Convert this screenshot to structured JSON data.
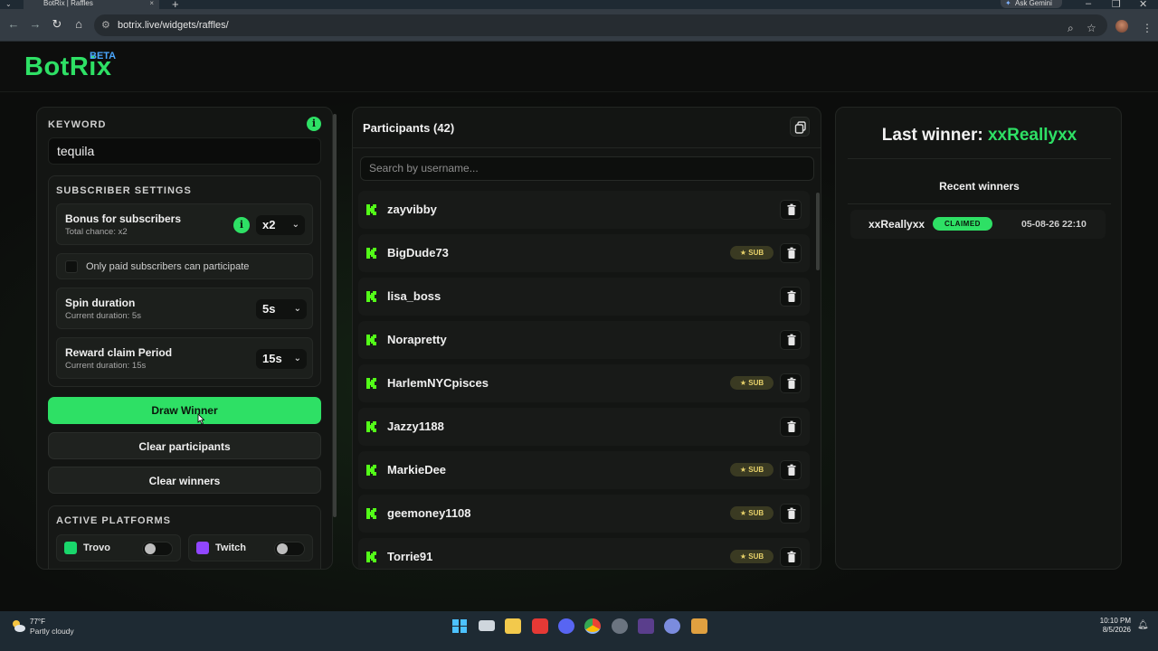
{
  "browser": {
    "tab_title": "BotRix | Raffles",
    "tab_close": "×",
    "new_tab": "+",
    "gemini": "Ask Gemini",
    "url": "botrix.live/widgets/raffles/",
    "window_controls": [
      "–",
      "❐",
      "✕"
    ]
  },
  "app": {
    "logo": "BotRix",
    "beta": "BETA"
  },
  "settings": {
    "keyword_label": "KEYWORD",
    "keyword_value": "tequila",
    "subscriber_title": "SUBSCRIBER SETTINGS",
    "bonus_title": "Bonus for subscribers",
    "bonus_sub": "Total chance: x2",
    "bonus_value": "x2",
    "paid_only_label": "Only paid subscribers can participate",
    "spin_title": "Spin duration",
    "spin_sub": "Current duration: 5s",
    "spin_value": "5s",
    "claim_title": "Reward claim Period",
    "claim_sub": "Current duration: 15s",
    "claim_value": "15s",
    "draw_button": "Draw Winner",
    "clear_participants": "Clear participants",
    "clear_winners": "Clear winners",
    "platforms_title": "ACTIVE PLATFORMS",
    "platforms": [
      {
        "name": "Trovo",
        "enabled": false,
        "color": "#19d66b"
      },
      {
        "name": "Twitch",
        "enabled": false,
        "color": "#9146ff"
      }
    ]
  },
  "participants": {
    "title": "Participants (42)",
    "search_placeholder": "Search by username...",
    "sub_label": "★ SUB",
    "rows": [
      {
        "name": "zayvibby",
        "sub": false
      },
      {
        "name": "BigDude73",
        "sub": true
      },
      {
        "name": "lisa_boss",
        "sub": false
      },
      {
        "name": "Norapretty",
        "sub": false
      },
      {
        "name": "HarlemNYCpisces",
        "sub": true
      },
      {
        "name": "Jazzy1188",
        "sub": false
      },
      {
        "name": "MarkieDee",
        "sub": true
      },
      {
        "name": "geemoney1108",
        "sub": true
      },
      {
        "name": "Torrie91",
        "sub": true
      }
    ]
  },
  "winners": {
    "last_winner_label": "Last winner:",
    "last_winner_name": "xxReallyxx",
    "recent_title": "Recent winners",
    "recent": [
      {
        "name": "xxReallyxx",
        "status": "CLAIMED",
        "date": "05-08-26 22:10"
      }
    ]
  },
  "taskbar": {
    "temp": "77°F",
    "weather": "Partly cloudy",
    "time": "10:10 PM",
    "date": "8/5/2026"
  },
  "colors": {
    "accent": "#2ee065",
    "kick": "#53fc18",
    "sub_badge": "#e8d26a"
  }
}
